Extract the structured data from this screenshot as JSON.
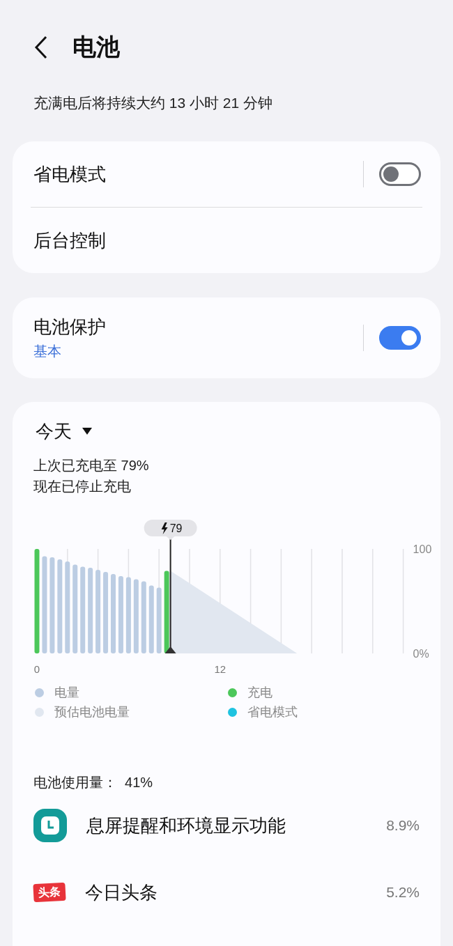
{
  "header": {
    "title": "电池"
  },
  "estimate": "充满电后将持续大约 13 小时 21 分钟",
  "groups": [
    [
      {
        "kind": "switch",
        "label": "省电模式",
        "on": false
      },
      {
        "kind": "link",
        "label": "后台控制"
      }
    ],
    [
      {
        "kind": "switch",
        "label": "电池保护",
        "subtitle": "基本",
        "on": true
      }
    ]
  ],
  "usage": {
    "period": "今天",
    "status": [
      "上次已充电至 79%",
      "现在已停止充电"
    ],
    "chart_data": {
      "type": "bar",
      "x": [
        0,
        0.5,
        1,
        1.5,
        2,
        2.5,
        3,
        3.5,
        4,
        4.5,
        5,
        5.5,
        6,
        6.5,
        7,
        7.5,
        8,
        8.5
      ],
      "series": [
        {
          "name": "电量",
          "color": "#bccde3",
          "values": [
            null,
            93,
            92,
            90,
            88,
            85,
            83,
            82,
            80,
            78,
            76,
            74,
            73,
            71,
            69,
            65,
            63,
            null
          ]
        },
        {
          "name": "充电",
          "color": "#4cc75a",
          "values": [
            100,
            null,
            null,
            null,
            null,
            null,
            null,
            null,
            null,
            null,
            null,
            null,
            null,
            null,
            null,
            null,
            null,
            79
          ]
        }
      ],
      "xlim": [
        0,
        24
      ],
      "ylim": [
        0,
        100
      ],
      "xticks": [
        0,
        12
      ],
      "yticks": [
        {
          "value": 0,
          "label": "0%"
        },
        {
          "value": 100,
          "label": "100"
        }
      ],
      "ref_lines": [
        {
          "axis": "x",
          "value": 8.75
        }
      ]
    },
    "marker_label": "79",
    "legend": [
      {
        "label": "预估电池电量",
        "color": "#e1e7f0"
      },
      {
        "label": "省电模式",
        "color": "#1fc3e0"
      }
    ],
    "total": "电池使用量：  41%",
    "apps": [
      {
        "kind": "clock",
        "name": "息屏提醒和环境显示功能",
        "percent": "8.9%"
      },
      {
        "kind": "badge",
        "badge": "头条",
        "name": "今日头条",
        "percent": "5.2%"
      }
    ]
  }
}
